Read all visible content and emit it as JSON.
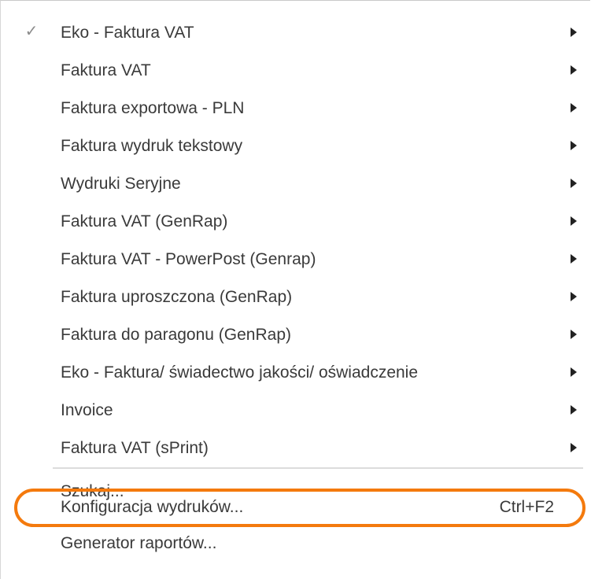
{
  "menu": {
    "items": [
      {
        "label": "Eko - Faktura VAT",
        "checked": true,
        "submenu": true
      },
      {
        "label": "Faktura VAT",
        "checked": false,
        "submenu": true
      },
      {
        "label": "Faktura exportowa - PLN",
        "checked": false,
        "submenu": true
      },
      {
        "label": "Faktura wydruk tekstowy",
        "checked": false,
        "submenu": true
      },
      {
        "label": "Wydruki Seryjne",
        "checked": false,
        "submenu": true
      },
      {
        "label": "Faktura VAT (GenRap)",
        "checked": false,
        "submenu": true
      },
      {
        "label": "Faktura VAT - PowerPost (Genrap)",
        "checked": false,
        "submenu": true
      },
      {
        "label": "Faktura uproszczona (GenRap)",
        "checked": false,
        "submenu": true
      },
      {
        "label": "Faktura do paragonu (GenRap)",
        "checked": false,
        "submenu": true
      },
      {
        "label": "Eko - Faktura/ świadectwo jakości/ oświadczenie",
        "checked": false,
        "submenu": true
      },
      {
        "label": "Invoice",
        "checked": false,
        "submenu": true
      },
      {
        "label": "Faktura VAT (sPrint)",
        "checked": false,
        "submenu": true
      },
      {
        "label": "Szukaj...",
        "checked": false,
        "submenu": false
      },
      {
        "label": "Konfiguracja wydruków...",
        "checked": false,
        "submenu": false,
        "shortcut": "Ctrl+F2",
        "highlighted": true
      },
      {
        "label": "Generator raportów...",
        "checked": false,
        "submenu": false
      }
    ],
    "check_glyph": "✓",
    "highlight_color": "#f47a0d",
    "icons": {
      "check": "check-icon",
      "submenu": "submenu-arrow-icon"
    }
  }
}
